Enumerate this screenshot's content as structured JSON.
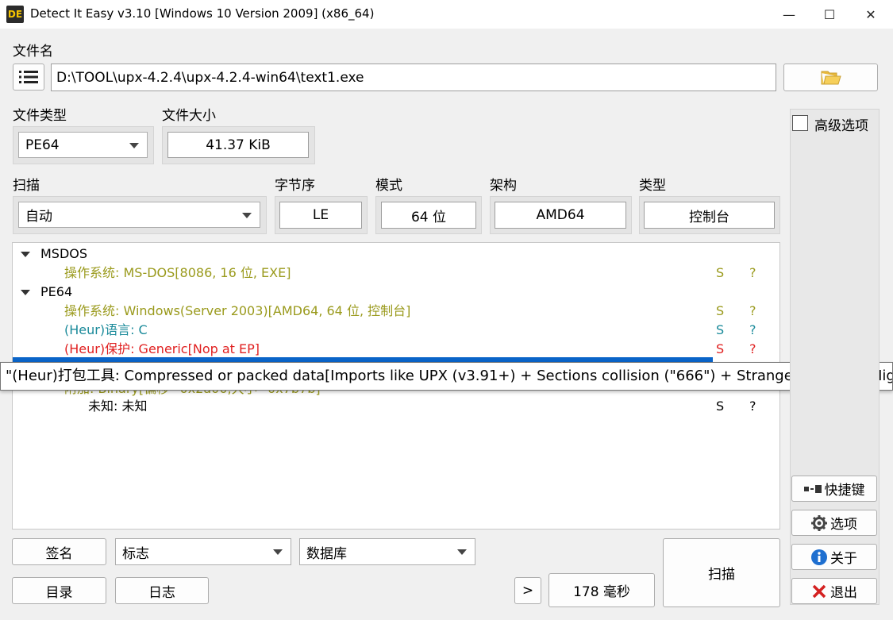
{
  "window": {
    "title": "Detect It Easy v3.10 [Windows 10 Version 2009] (x86_64)",
    "icon_text": "DE",
    "minimize": "—",
    "maximize": "☐",
    "close": "✕"
  },
  "file": {
    "label": "文件名",
    "path": "D:\\TOOL\\upx-4.2.4\\upx-4.2.4-win64\\text1.exe",
    "menu_icon": "list-icon",
    "open_icon": "folder-icon"
  },
  "file_type": {
    "label": "文件类型",
    "value": "PE64"
  },
  "file_size": {
    "label": "文件大小",
    "value": "41.37 KiB"
  },
  "scan": {
    "label": "扫描",
    "value": "自动"
  },
  "endianness": {
    "label": "字节序",
    "value": "LE"
  },
  "mode": {
    "label": "模式",
    "value": "64 位"
  },
  "arch": {
    "label": "架构",
    "value": "AMD64"
  },
  "type": {
    "label": "类型",
    "value": "控制台"
  },
  "tree": {
    "groups": [
      {
        "name": "MSDOS"
      },
      {
        "name": "PE64"
      }
    ],
    "rows": [
      {
        "text": "操作系统: MS-DOS[8086, 16 位, EXE]",
        "s": "S",
        "q": "?"
      },
      {
        "text": "操作系统: Windows(Server 2003)[AMD64, 64 位, 控制台]",
        "s": "S",
        "q": "?"
      },
      {
        "text": "(Heur)语言: C",
        "s": "S",
        "q": "?"
      },
      {
        "text": "(Heur)保护: Generic[Nop at EP]",
        "s": "S",
        "q": "?"
      },
      {
        "text": "附加: Binary[偏移=0x2a00,大小=0x7b7b]",
        "s": "",
        "q": ""
      },
      {
        "text": "未知: 未知",
        "s": "S",
        "q": "?"
      }
    ],
    "tooltip": "\"(Heur)打包工具: Compressed or packed data[Imports like UPX (v3.91+) + Sections collision (\"666\") + Strange overlay + High entropy]"
  },
  "advanced": {
    "label": "高级选项",
    "checked": false
  },
  "side_buttons": {
    "shortcuts": "快捷键",
    "options": "选项",
    "about": "关于",
    "exit": "退出"
  },
  "bottom": {
    "signature": "签名",
    "flags": "标志",
    "database": "数据库",
    "directory": "目录",
    "log": "日志",
    "next": ">",
    "time": "178 毫秒",
    "scan": "扫描"
  },
  "colors": {
    "olive": "#9a9a1c",
    "teal": "#1a8a9a",
    "red": "#e02020",
    "selection": "#0a64c8"
  }
}
